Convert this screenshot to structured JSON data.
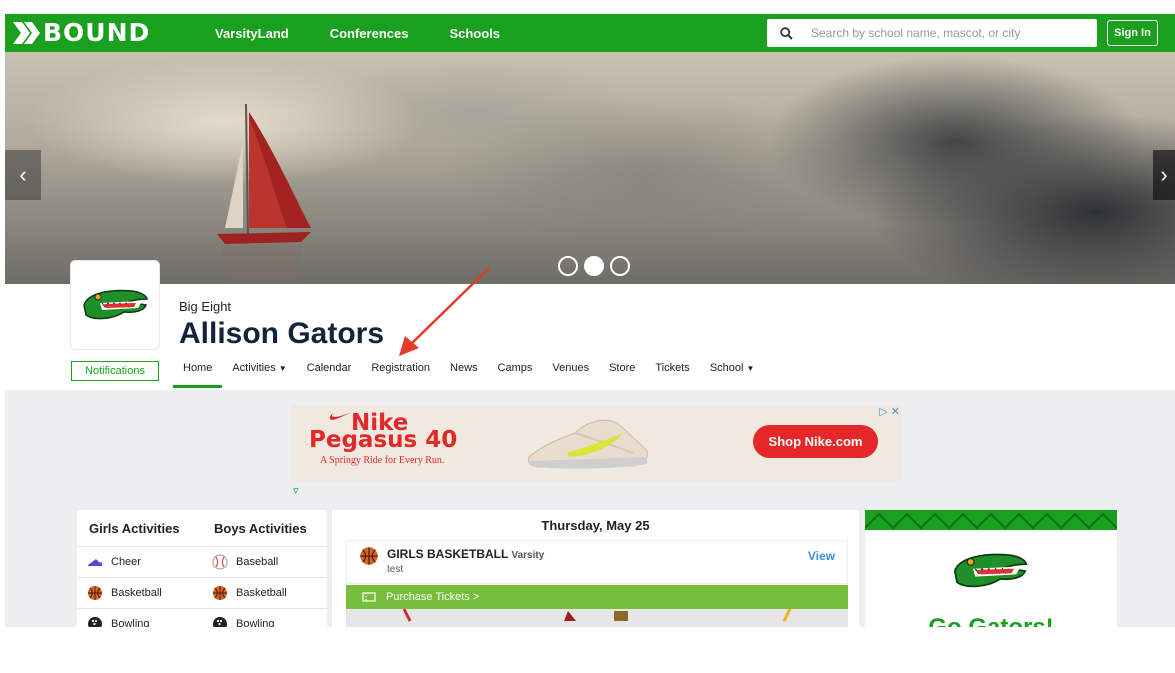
{
  "brand": {
    "logo_text": "BOUND",
    "accent": "#1aa01f"
  },
  "topnav": {
    "links": [
      "VarsityLand",
      "Conferences",
      "Schools"
    ],
    "search_placeholder": "Search by school name, mascot, or city",
    "signin_label": "Sign In"
  },
  "hero": {
    "slides": 3,
    "active_slide": 2,
    "prev_icon": "chevron-left-icon",
    "next_icon": "chevron-right-icon"
  },
  "school": {
    "conference": "Big Eight",
    "name": "Allison Gators",
    "notifications_label": "Notifications",
    "tabs": [
      {
        "label": "Home",
        "active": true
      },
      {
        "label": "Activities",
        "dropdown": true
      },
      {
        "label": "Calendar"
      },
      {
        "label": "Registration"
      },
      {
        "label": "News"
      },
      {
        "label": "Camps"
      },
      {
        "label": "Venues"
      },
      {
        "label": "Store"
      },
      {
        "label": "Tickets"
      },
      {
        "label": "School",
        "dropdown": true
      }
    ]
  },
  "ad": {
    "brand_line1": "Nike",
    "brand_line2": "Pegasus 40",
    "tagline": "A Springy Ride for Every Run.",
    "cta": "Shop Nike.com",
    "controls": "▷ ✕"
  },
  "activities": {
    "girls_header": "Girls Activities",
    "boys_header": "Boys Activities",
    "rows": [
      {
        "girls": "Cheer",
        "girls_icon": "cheer-shoe-icon",
        "boys": "Baseball",
        "boys_icon": "baseball-icon"
      },
      {
        "girls": "Basketball",
        "girls_icon": "basketball-icon",
        "boys": "Basketball",
        "boys_icon": "basketball-icon"
      },
      {
        "girls": "Bowling",
        "girls_icon": "bowling-ball-icon",
        "boys": "Bowling",
        "boys_icon": "bowling-ball-icon"
      }
    ]
  },
  "events": {
    "date": "Thursday, May 25",
    "event_title": "GIRLS BASKETBALL",
    "event_level": "Varsity",
    "event_subtitle": "test",
    "view_label": "View",
    "purchase_label": "Purchase Tickets >"
  },
  "panel": {
    "slogan": "Go Gators!"
  }
}
